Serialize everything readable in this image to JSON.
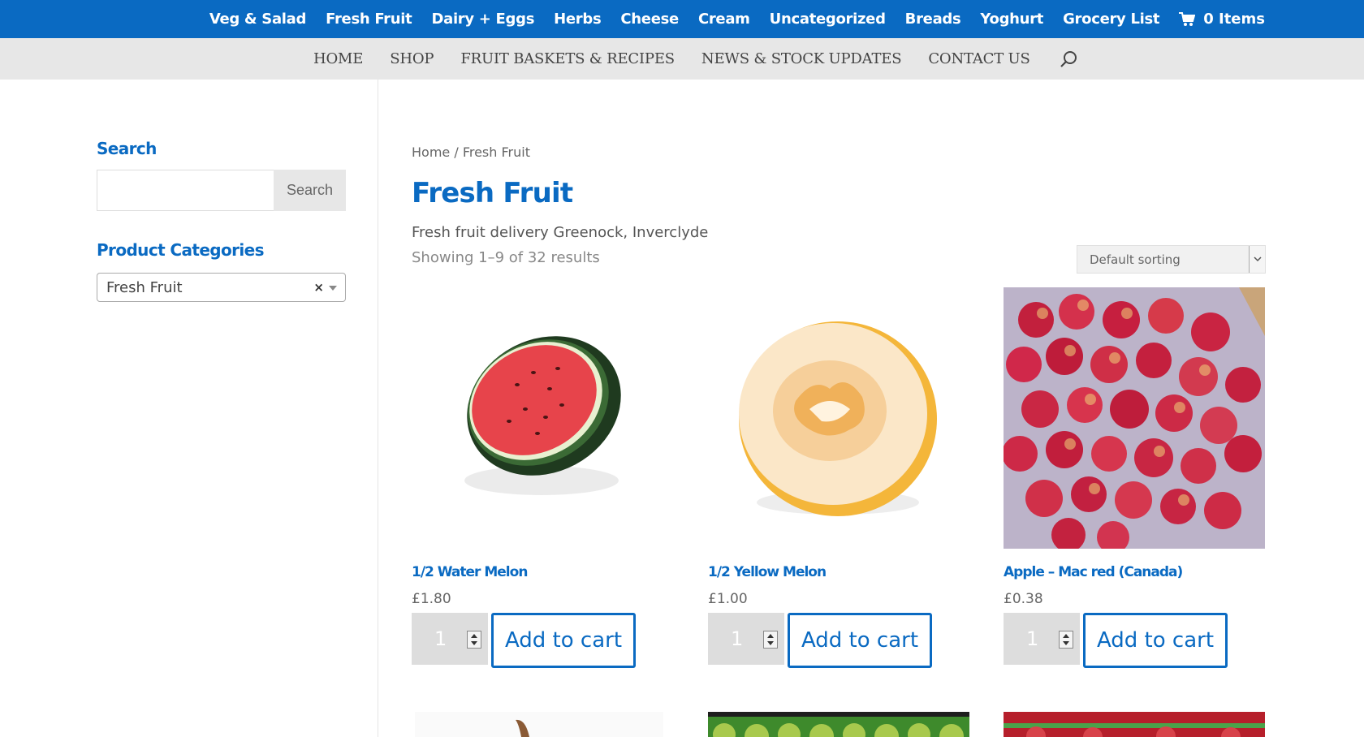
{
  "top_categories": [
    "Veg & Salad",
    "Fresh Fruit",
    "Dairy + Eggs",
    "Herbs",
    "Cheese",
    "Cream",
    "Uncategorized",
    "Breads",
    "Yoghurt",
    "Grocery List"
  ],
  "cart": {
    "label": "0 Items",
    "icon": "cart-icon"
  },
  "main_nav": [
    "HOME",
    "SHOP",
    "FRUIT BASKETS & RECIPES",
    "NEWS & STOCK UPDATES",
    "CONTACT US"
  ],
  "sidebar": {
    "search_title": "Search",
    "search_input_value": "",
    "search_button": "Search",
    "categories_title": "Product Categories",
    "categories_selected": "Fresh Fruit",
    "clear_symbol": "×"
  },
  "breadcrumb": {
    "home": "Home",
    "separator": " / ",
    "current": "Fresh Fruit"
  },
  "page_title": "Fresh Fruit",
  "category_description": "Fresh fruit delivery Greenock, Inverclyde",
  "result_count": "Showing 1–9 of 32 results",
  "sorting": {
    "selected": "Default sorting"
  },
  "products": [
    {
      "name": "1/2 Water Melon",
      "price": "£1.80",
      "qty": "1",
      "button": "Add to cart"
    },
    {
      "name": "1/2 Yellow Melon",
      "price": "£1.00",
      "qty": "1",
      "button": "Add to cart"
    },
    {
      "name": "Apple – Mac red (Canada)",
      "price": "£0.38",
      "qty": "1",
      "button": "Add to cart"
    }
  ],
  "colors": {
    "brand_blue": "#0a6ac2",
    "nav_gray": "#e7e7e7"
  }
}
